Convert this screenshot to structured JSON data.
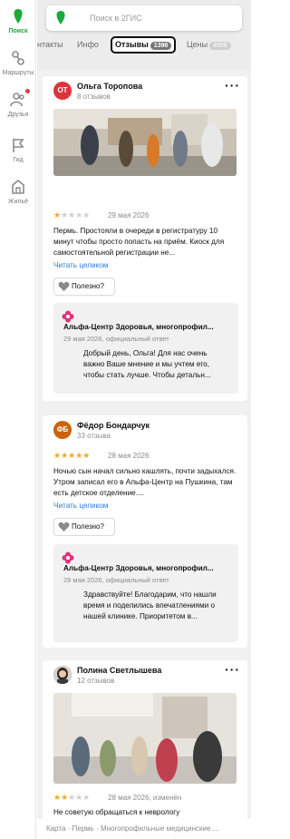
{
  "sidebar": {
    "items": [
      {
        "label": "Поиск",
        "icon": "search-logo-icon"
      },
      {
        "label": "Маршруты",
        "icon": "routes-icon"
      },
      {
        "label": "Друзья",
        "icon": "friends-icon"
      },
      {
        "label": "Гид",
        "icon": "flag-icon"
      },
      {
        "label": "Жильё",
        "icon": "housing-icon"
      }
    ]
  },
  "search": {
    "placeholder": "Поиск в 2ГИС"
  },
  "tabs": {
    "contacts": "нтакты",
    "info": "Инфо",
    "reviews": "Отзывы",
    "reviews_count": "1396",
    "prices": "Цены",
    "prices_count": "4906"
  },
  "reviews": [
    {
      "initials": "ОТ",
      "avatar_color": "#e0323a",
      "name": "Ольга Торопова",
      "count": "8 отзывов",
      "rating": 1,
      "date": "29 мая 2026",
      "text": "Пермь. Простояли в очереди в регистратуру 10 минут чтобы просто попасть на приём. Киоск для самостоятельной регистрации не...",
      "read_more": "Читать целиком",
      "useful": "Полезно?",
      "reply": {
        "org": "Альфа-Центр Здоровья, многопрофил...",
        "meta": "29 мая 2026, официальный ответ",
        "text": "Добрый день, Ольга! Для нас очень важно Ваше мнение и мы учтем его, чтобы стать лучше. Чтобы детальн..."
      }
    },
    {
      "initials": "ФБ",
      "avatar_color": "#c9640c",
      "name": "Фёдор Бондарчук",
      "count": "33 отзыва",
      "rating": 5,
      "date": "28 мая 2026",
      "text": "Ночью сын начал сильно кашлять, почти задыхался. Утром записал его в Альфа-Центр на Пушкина, там есть детское отделение....",
      "read_more": "Читать целиком",
      "useful": "Полезно?",
      "reply": {
        "org": "Альфа-Центр Здоровья, многопрофил...",
        "meta": "28 мая 2026, официальный ответ",
        "text": "Здравствуйте! Благодарим, что нашли время и поделились впечатлениями о нашей клинике. Приоритетом в..."
      }
    },
    {
      "name": "Полина Светлышева",
      "count": "12 отзывов",
      "rating": 2,
      "date": "28 мая 2026, изменён",
      "text": "Не советую обращаться к неврологу"
    }
  ],
  "footer": {
    "breadcrumb": "Карта · Пермь · Многопрофильные медицинские ..."
  },
  "colors": {
    "brand_green": "#1baa3a",
    "star": "#f5a623",
    "link": "#2a7bd8",
    "org_logo": "#e0327a"
  }
}
